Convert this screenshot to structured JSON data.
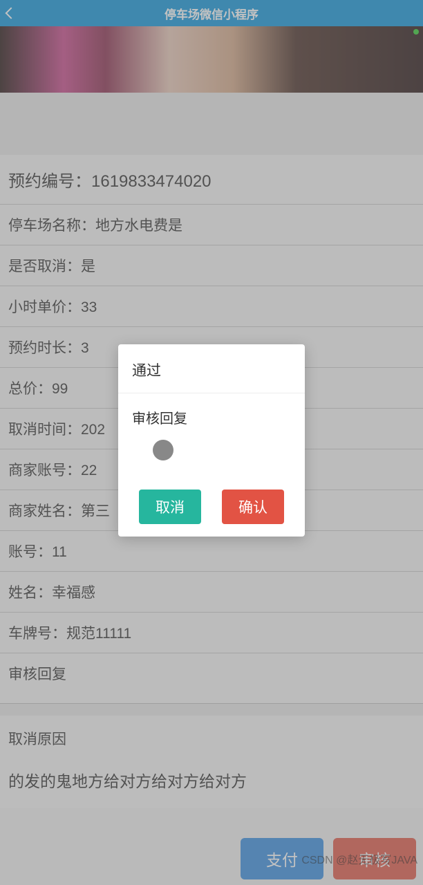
{
  "header": {
    "title": "停车场微信小程序"
  },
  "details": {
    "order_no": {
      "label": "预约编号：",
      "value": "1619833474020"
    },
    "park_name": {
      "label": "停车场名称：",
      "value": "地方水电费是"
    },
    "cancelled": {
      "label": "是否取消：",
      "value": "是"
    },
    "hour_price": {
      "label": "小时单价：",
      "value": "33"
    },
    "duration": {
      "label": "预约时长：",
      "value": "3"
    },
    "total": {
      "label": "总价：",
      "value": "99"
    },
    "cancel_time": {
      "label": "取消时间：",
      "value": "202"
    },
    "merchant_account": {
      "label": "商家账号：",
      "value": "22"
    },
    "merchant_name": {
      "label": "商家姓名：",
      "value": "第三"
    },
    "account": {
      "label": "账号：",
      "value": "11"
    },
    "name": {
      "label": "姓名：",
      "value": "幸福感"
    },
    "plate": {
      "label": "车牌号：",
      "value": "规范11111"
    },
    "audit_reply": {
      "label": "审核回复",
      "value": ""
    },
    "cancel_reason": {
      "label": "取消原因",
      "value": "的发的鬼地方给对方给对方给对方"
    }
  },
  "buttons": {
    "pay": "支付",
    "audit": "审核"
  },
  "modal": {
    "title": "通过",
    "field_label": "审核回复",
    "cancel": "取消",
    "confirm": "确认"
  },
  "watermark": "CSDN @赵无极写JAVA"
}
